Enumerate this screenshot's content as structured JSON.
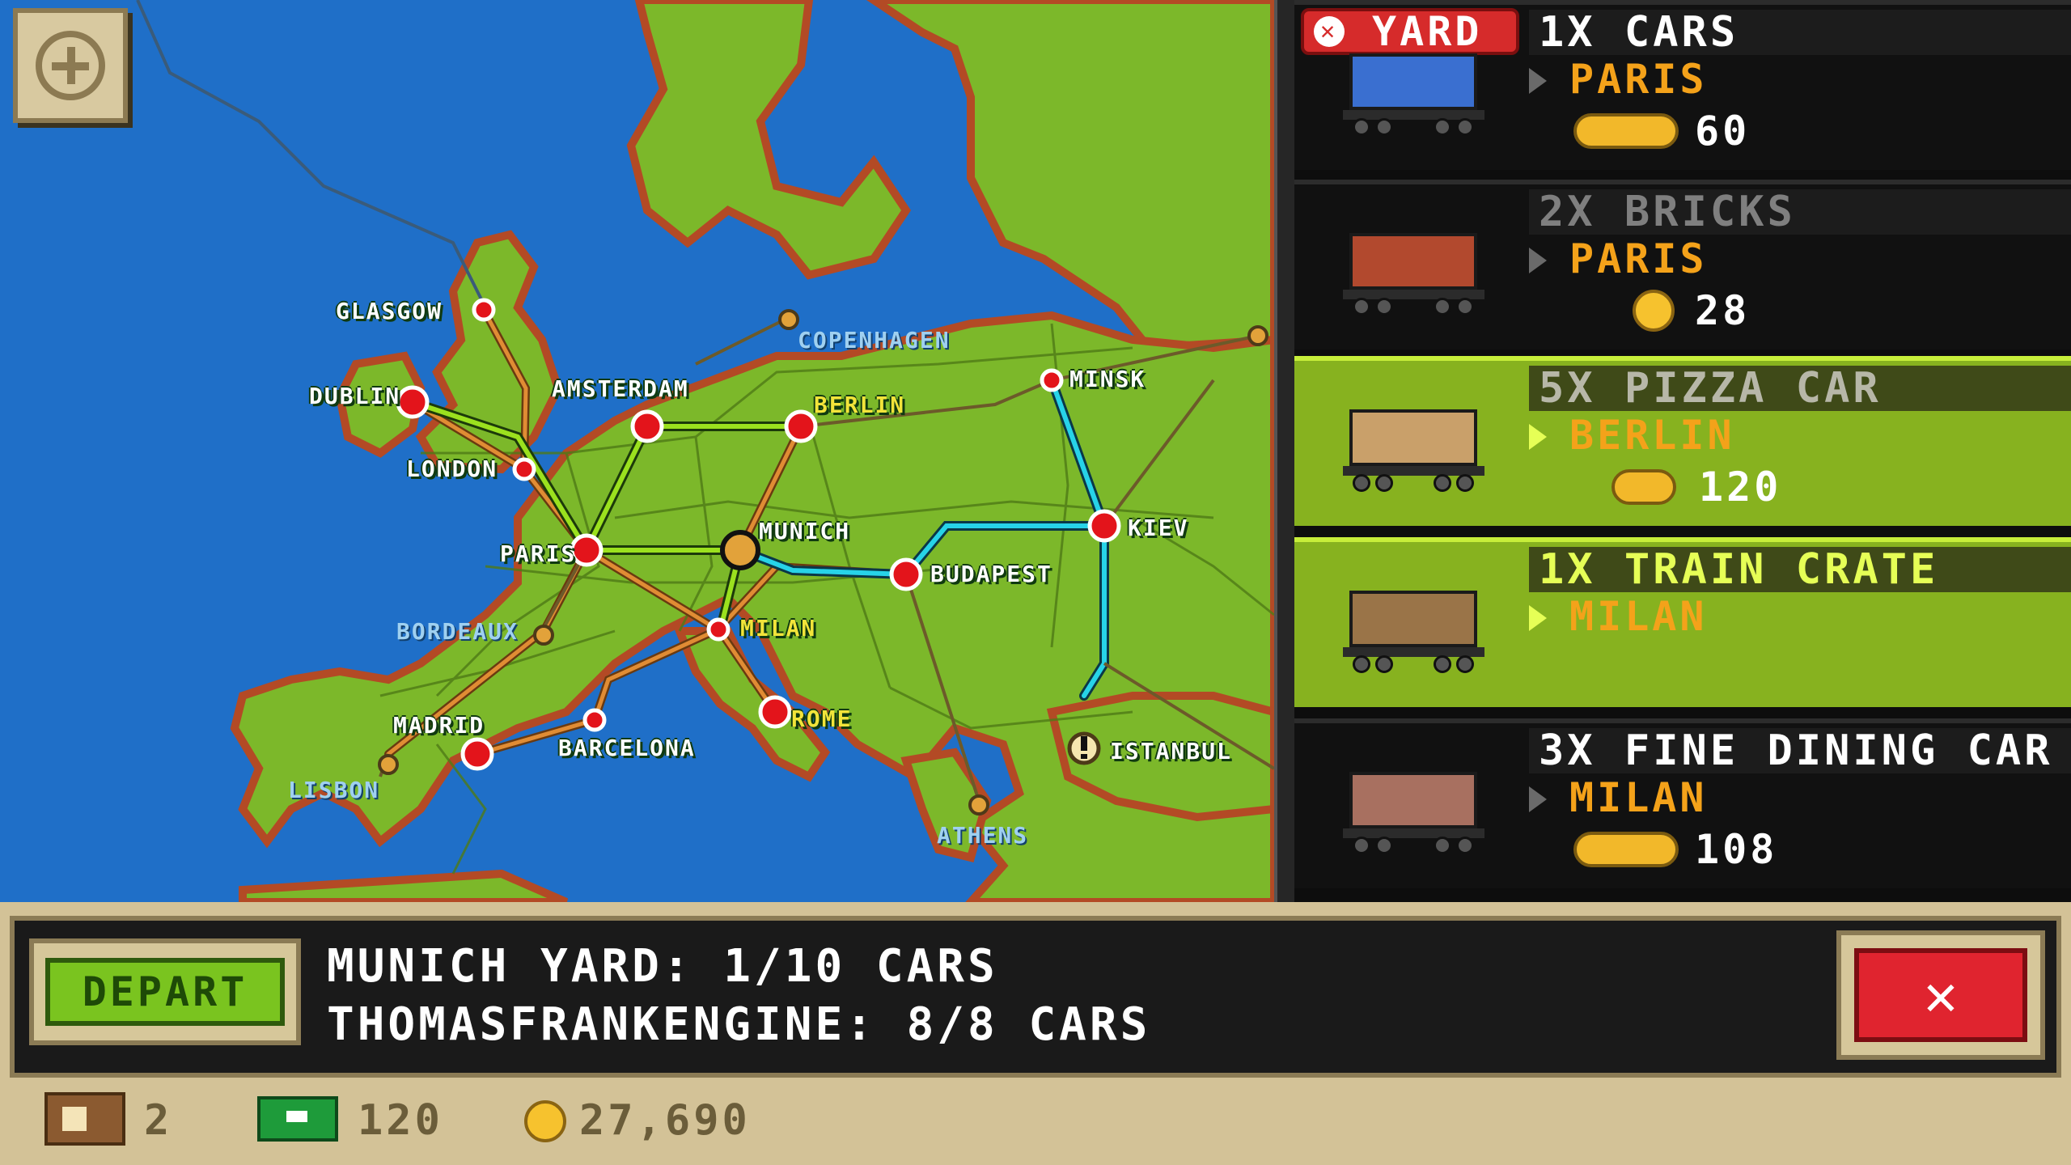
{
  "map": {
    "zoom_button": "zoom-in",
    "cities": [
      {
        "name": "GLASGOW",
        "style": "white"
      },
      {
        "name": "DUBLIN",
        "style": "white"
      },
      {
        "name": "LONDON",
        "style": "white"
      },
      {
        "name": "AMSTERDAM",
        "style": "white"
      },
      {
        "name": "BERLIN",
        "style": "yellow"
      },
      {
        "name": "COPENHAGEN",
        "style": "muted"
      },
      {
        "name": "MINSK",
        "style": "white"
      },
      {
        "name": "PARIS",
        "style": "white"
      },
      {
        "name": "MUNICH",
        "style": "white"
      },
      {
        "name": "BUDAPEST",
        "style": "white"
      },
      {
        "name": "KIEV",
        "style": "white"
      },
      {
        "name": "BORDEAUX",
        "style": "muted"
      },
      {
        "name": "MILAN",
        "style": "yellow"
      },
      {
        "name": "MADRID",
        "style": "white"
      },
      {
        "name": "BARCELONA",
        "style": "white"
      },
      {
        "name": "ROME",
        "style": "yellow"
      },
      {
        "name": "ISTANBUL",
        "style": "white"
      },
      {
        "name": "LISBON",
        "style": "muted"
      },
      {
        "name": "ATHENS",
        "style": "muted"
      }
    ]
  },
  "panel": {
    "yard_badge": "YARD",
    "cards": [
      {
        "title": "1X CARS",
        "dest": "PARIS",
        "pay": "60",
        "car_color": "#3a6fd0",
        "selected": false
      },
      {
        "title": "2X BRICKS",
        "dest": "PARIS",
        "pay": "28",
        "car_color": "#b2492e",
        "selected": false
      },
      {
        "title": "5X PIZZA CAR",
        "dest": "BERLIN",
        "pay": "120",
        "car_color": "#c9a06a",
        "selected": true
      },
      {
        "title": "1X TRAIN CRATE",
        "dest": "MILAN",
        "pay": "",
        "car_color": "#9a7448",
        "selected": true
      },
      {
        "title": "3X FINE DINING CAR",
        "dest": "MILAN",
        "pay": "108",
        "car_color": "#a87060",
        "selected": false
      }
    ]
  },
  "bottom": {
    "depart_label": "DEPART",
    "yard_line": "MUNICH YARD: 1/10 CARS",
    "engine_line": "THOMASFRANKENGINE: 8/8 CARS",
    "close_label": "✕",
    "stats": {
      "crates": "2",
      "cash": "120",
      "coins": "27,690"
    }
  },
  "colors": {
    "sea": "#1f6fc8",
    "land": "#7cb82a",
    "selected_card": "#87b21f",
    "active_route": "#27d3e8",
    "green_route": "#9be11e",
    "orange_route": "#d98a2e"
  }
}
